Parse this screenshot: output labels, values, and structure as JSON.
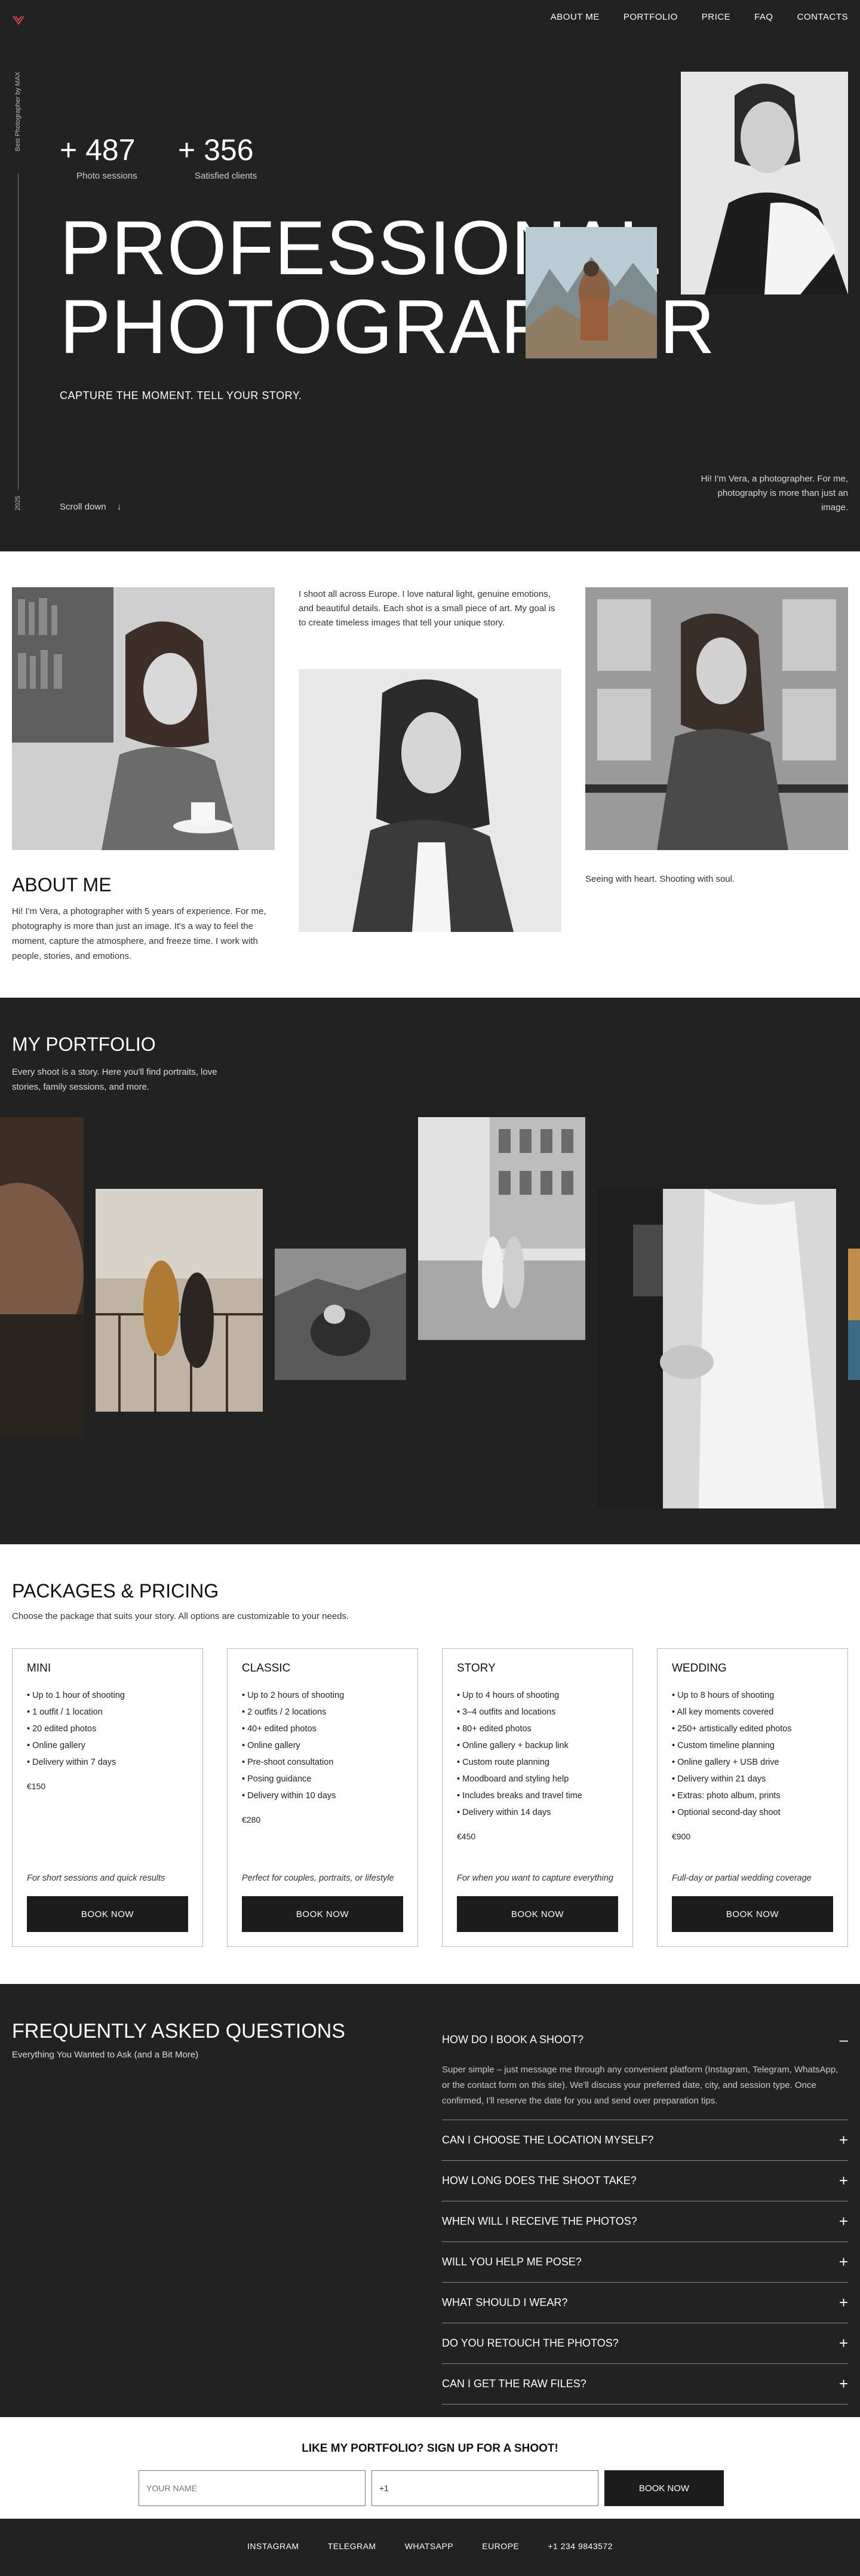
{
  "nav": {
    "items": [
      "ABOUT ME",
      "PORTFOLIO",
      "PRICE",
      "FAQ",
      "CONTACTS"
    ]
  },
  "hero": {
    "side_label": "Best Photographer by MAX",
    "year": "2025",
    "stats": [
      {
        "value": "+ 487",
        "label": "Photo sessions"
      },
      {
        "value": "+ 356",
        "label": "Satisfied clients"
      }
    ],
    "title_line1": "PROFESSIONAL",
    "title_line2": "PHOTOGRAPHER",
    "subtitle": "CAPTURE THE MOMENT. TELL YOUR STORY.",
    "scroll_label": "Scroll down",
    "intro": "Hi! I'm Vera, a photographer. For me, photography is more than just an image."
  },
  "about": {
    "intro": "I shoot all across Europe. I love natural light, genuine emotions, and beautiful details. Each shot is a small piece of art. My goal is to create timeless images that tell your unique story.",
    "title": "ABOUT ME",
    "description": "Hi! I'm Vera, a photographer with 5 years of experience. For me, photography is more than just an image. It's a way to feel the moment, capture the atmosphere, and freeze time. I work with people, stories, and emotions.",
    "tagline": "Seeing with heart. Shooting with soul."
  },
  "portfolio": {
    "title": "MY PORTFOLIO",
    "description": "Every shoot is a story. Here you'll find portraits, love stories, family sessions, and more."
  },
  "pricing": {
    "title": "PACKAGES & PRICING",
    "description": "Choose the package that suits your story. All options are customizable to your needs.",
    "button_label": "BOOK NOW",
    "packages": [
      {
        "name": "MINI",
        "features": [
          "Up to 1 hour of shooting",
          "1 outfit / 1 location",
          "20 edited photos",
          "Online gallery",
          "Delivery within 7 days"
        ],
        "price": "€150",
        "note": "For short sessions and quick results"
      },
      {
        "name": "CLASSIC",
        "features": [
          "Up to 2 hours of shooting",
          "2 outfits / 2 locations",
          "40+ edited photos",
          "Online gallery",
          "Pre-shoot consultation",
          "Posing guidance",
          "Delivery within 10 days"
        ],
        "price": "€280",
        "note": "Perfect for couples, portraits, or lifestyle"
      },
      {
        "name": "STORY",
        "features": [
          "Up to 4 hours of shooting",
          "3–4 outfits and locations",
          "80+ edited photos",
          "Online gallery + backup link",
          "Custom route planning",
          "Moodboard and styling help",
          "Includes breaks and travel time",
          "Delivery within 14 days"
        ],
        "price": "€450",
        "note": "For when you want to capture everything"
      },
      {
        "name": "WEDDING",
        "features": [
          "Up to 8 hours of shooting",
          "All key moments covered",
          "250+ artistically edited photos",
          "Custom timeline planning",
          "Online gallery + USB drive",
          "Delivery within 21 days",
          "Extras: photo album, prints",
          "Optional second-day shoot"
        ],
        "price": "€900",
        "note": "Full-day or partial wedding coverage"
      }
    ]
  },
  "faq": {
    "title": "FREQUENTLY ASKED QUESTIONS",
    "subtitle": "Everything You Wanted to Ask (and a Bit More)",
    "items": [
      {
        "q": "HOW DO I BOOK A SHOOT?",
        "sign": "–",
        "a": "Super simple – just message me through any convenient platform (Instagram, Telegram, WhatsApp, or the contact form on this site). We'll discuss your preferred date, city, and session type. Once confirmed, I'll reserve the date for you and send over preparation tips."
      },
      {
        "q": "CAN I CHOOSE THE LOCATION MYSELF?",
        "sign": "+"
      },
      {
        "q": "HOW LONG DOES THE SHOOT TAKE?",
        "sign": "+"
      },
      {
        "q": "WHEN WILL I RECEIVE THE PHOTOS?",
        "sign": "+"
      },
      {
        "q": "WILL YOU HELP ME POSE?",
        "sign": "+"
      },
      {
        "q": "WHAT SHOULD I WEAR?",
        "sign": "+"
      },
      {
        "q": "DO YOU RETOUCH THE PHOTOS?",
        "sign": "+"
      },
      {
        "q": "CAN I GET THE RAW FILES?",
        "sign": "+"
      }
    ]
  },
  "signup": {
    "title": "LIKE MY PORTFOLIO? SIGN UP FOR A SHOOT!",
    "name_placeholder": "YOUR NAME",
    "phone_value": "+1",
    "button_label": "BOOK NOW"
  },
  "footer": {
    "links": [
      "INSTAGRAM",
      "TELEGRAM",
      "WHATSAPP",
      "EUROPE",
      "+1 234 9843572"
    ]
  },
  "colors": {
    "dark_bg": "#222222",
    "accent": "#d64545",
    "button": "#1c1c1c"
  }
}
